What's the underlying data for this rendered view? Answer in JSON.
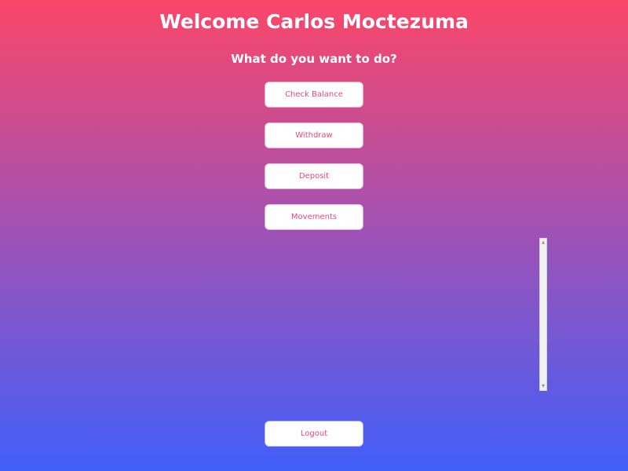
{
  "header": {
    "title": "Welcome Carlos Moctezuma",
    "subtitle": "What do you want to do?"
  },
  "menu": {
    "items": [
      {
        "label": "Check Balance"
      },
      {
        "label": "Withdraw"
      },
      {
        "label": "Deposit"
      },
      {
        "label": "Movements"
      }
    ]
  },
  "logout": {
    "label": "Logout"
  },
  "scrollbar": {
    "up_icon": "scroll-up-arrow-icon",
    "down_icon": "scroll-down-arrow-icon"
  },
  "colors": {
    "gradient_top": "#fb4668",
    "gradient_mid": "#9e52b6",
    "gradient_bottom": "#415ffa",
    "button_text": "#e8467c",
    "button_background": "#ffffff"
  }
}
